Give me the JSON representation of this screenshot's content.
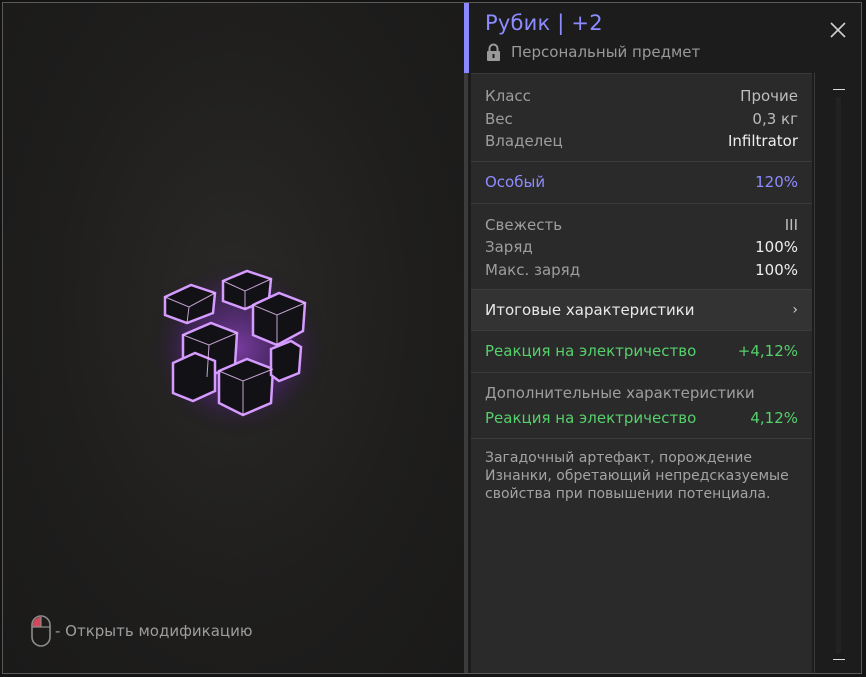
{
  "item": {
    "title": "Рубик | +2",
    "subtitle": "Персональный предмет"
  },
  "basic": [
    {
      "label": "Класс",
      "value": "Прочие"
    },
    {
      "label": "Вес",
      "value": "0,3 кг"
    },
    {
      "label": "Владелец",
      "value": "Infiltrator"
    }
  ],
  "special": {
    "label": "Особый",
    "value": "120%"
  },
  "state": [
    {
      "label": "Свежесть",
      "value": "III"
    },
    {
      "label": "Заряд",
      "value": "100%"
    },
    {
      "label": "Макс. заряд",
      "value": "100%"
    }
  ],
  "summary": {
    "label": "Итоговые характеристики",
    "chevron": "›"
  },
  "final_stat": {
    "label": "Реакция на электричество",
    "value": "+4,12%"
  },
  "extra": {
    "heading": "Дополнительные характеристики",
    "label": "Реакция на электричество",
    "value": "4,12%"
  },
  "description": "Загадочный артефакт, порождение Изнанки, обретающий непредсказуемые свойства при повышении потенциала.",
  "hint": "- Открыть модификацию",
  "icons": {
    "lock": "lock-icon",
    "close": "close-icon",
    "mouse": "mouse-icon",
    "artifact": "cube-artifact-image"
  },
  "colors": {
    "accent": "#8d8cff",
    "positive": "#55d06b"
  }
}
